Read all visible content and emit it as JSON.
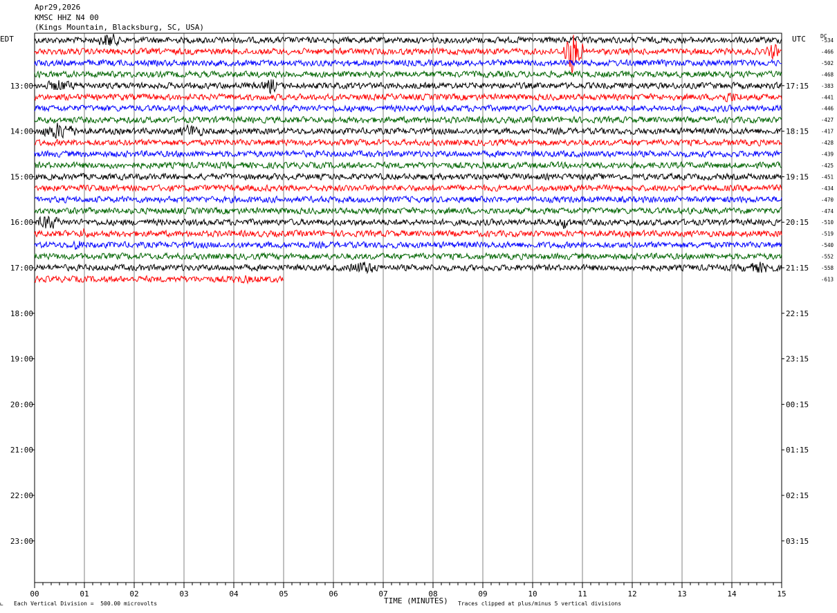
{
  "header": {
    "date": "Apr29,2026",
    "station": "KMSC HHZ N4 00",
    "location": "(Kings Mountain, Blacksburg, SC, USA)"
  },
  "left_tz": "EDT",
  "right_tz": "UTC",
  "dc_label": "DC",
  "footer": {
    "scale_note": "Each Vertical Division =  500.00 microvolts",
    "xlabel": "TIME (MINUTES)",
    "clip_note": "Traces clipped at plus/minus 5 vertical divisions"
  },
  "colors": {
    "trace_cycle": [
      "#000000",
      "#ff0000",
      "#0000ff",
      "#006400"
    ],
    "grid": "#808080"
  },
  "chart_data": {
    "type": "line",
    "title": "KMSC HHZ N4 00",
    "xlabel": "TIME (MINUTES)",
    "x_ticks": [
      "00",
      "01",
      "02",
      "03",
      "04",
      "05",
      "06",
      "07",
      "08",
      "09",
      "10",
      "11",
      "12",
      "13",
      "14",
      "15"
    ],
    "xlim": [
      0,
      15
    ],
    "left_hour_labels": [
      "13:00",
      "14:00",
      "15:00",
      "16:00",
      "17:00",
      "18:00",
      "19:00",
      "20:00",
      "21:00",
      "22:00",
      "23:00"
    ],
    "right_hour_labels": [
      "17:15",
      "18:15",
      "19:15",
      "20:15",
      "21:15",
      "22:15",
      "23:15",
      "00:15",
      "01:15",
      "02:15",
      "03:15"
    ],
    "dc_offsets": [
      "-534",
      "-466",
      "-502",
      "-468",
      "-383",
      "-441",
      "-446",
      "-427",
      "-417",
      "-428",
      "-439",
      "-425",
      "-451",
      "-434",
      "-470",
      "-474",
      "-510",
      "-519",
      "-540",
      "-552",
      "-558",
      "-613"
    ],
    "row_count": 22,
    "last_row_end_minute": 5,
    "events": [
      {
        "row": 0,
        "start": 1.3,
        "end": 1.7,
        "amp": 3.0
      },
      {
        "row": 1,
        "start": 10.6,
        "end": 11.0,
        "amp": 8.0
      },
      {
        "row": 1,
        "start": 14.7,
        "end": 14.95,
        "amp": 3.0
      },
      {
        "row": 4,
        "start": 0.2,
        "end": 0.8,
        "amp": 2.2
      },
      {
        "row": 4,
        "start": 4.6,
        "end": 4.9,
        "amp": 3.0
      },
      {
        "row": 5,
        "start": 13.7,
        "end": 14.2,
        "amp": 2.0
      },
      {
        "row": 8,
        "start": 0.1,
        "end": 0.9,
        "amp": 3.0
      },
      {
        "row": 8,
        "start": 2.9,
        "end": 3.4,
        "amp": 2.5
      },
      {
        "row": 16,
        "start": 0.05,
        "end": 0.5,
        "amp": 3.0
      },
      {
        "row": 16,
        "start": 10.5,
        "end": 10.8,
        "amp": 2.5
      },
      {
        "row": 17,
        "start": 0.9,
        "end": 1.1,
        "amp": 2.0
      },
      {
        "row": 18,
        "start": 0.7,
        "end": 1.0,
        "amp": 2.0
      },
      {
        "row": 20,
        "start": 6.3,
        "end": 6.9,
        "amp": 2.5
      },
      {
        "row": 20,
        "start": 14.2,
        "end": 14.9,
        "amp": 2.0
      },
      {
        "row": 21,
        "start": 3.8,
        "end": 4.5,
        "amp": 1.5
      }
    ]
  }
}
